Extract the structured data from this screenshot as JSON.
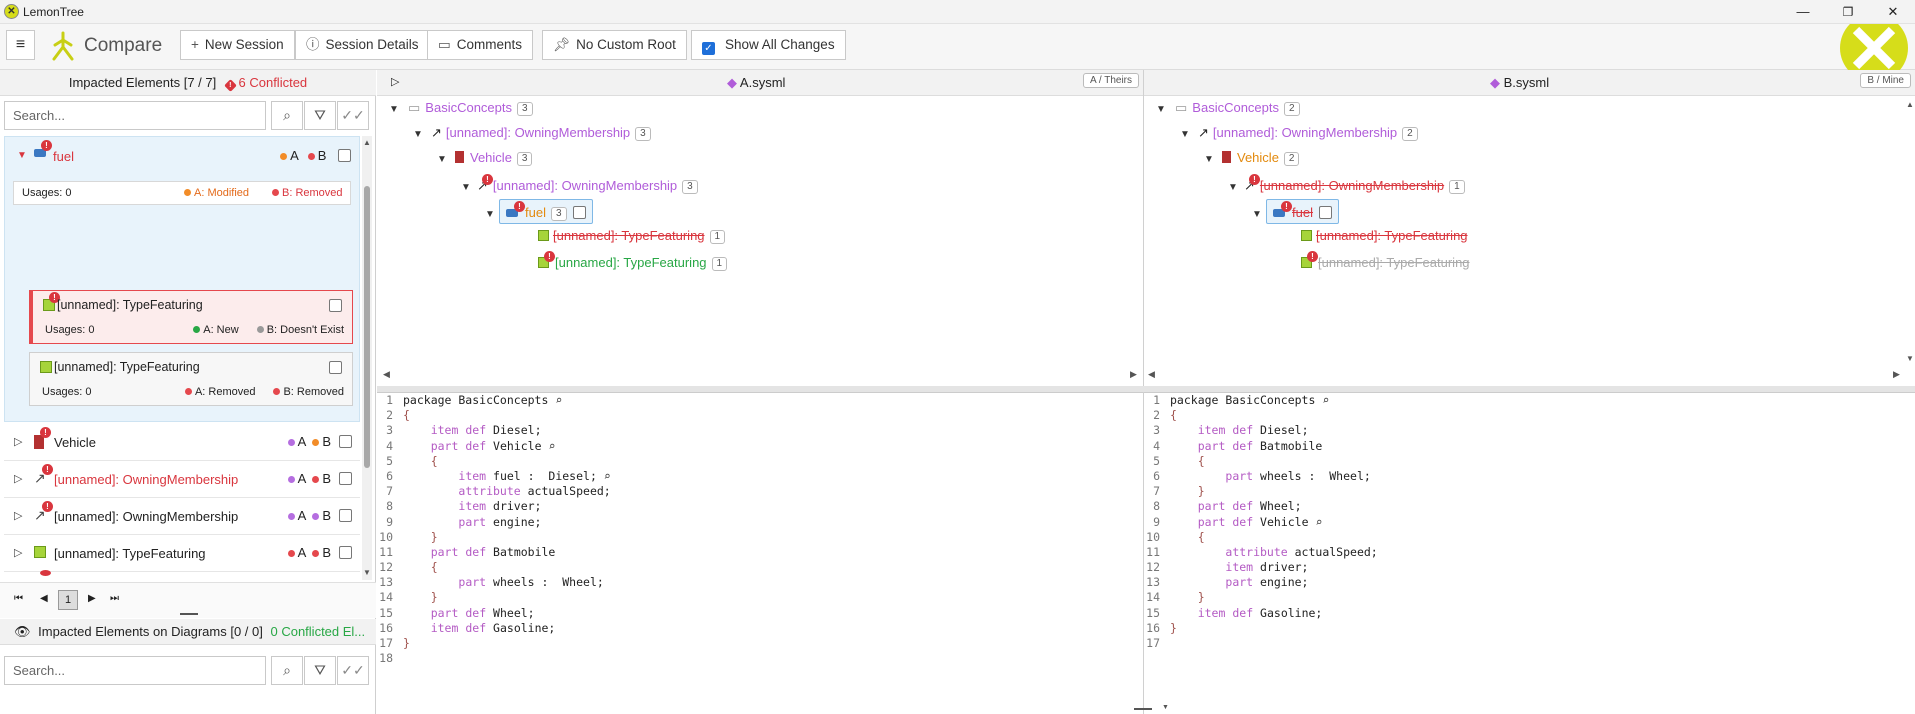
{
  "window": {
    "title": "LemonTree",
    "minimize": "—",
    "maximize": "❐",
    "close": "✕"
  },
  "toolbar": {
    "menu_icon": "≡",
    "app_name": "Compare",
    "new_session": "New Session",
    "session_details": "Session Details",
    "comments": "Comments",
    "no_custom_root": "No Custom Root",
    "show_all_changes": "Show All Changes"
  },
  "impacted": {
    "header": "Impacted Elements [7 / 7]",
    "conflicted": "6 Conflicted",
    "search_placeholder": "Search...",
    "rows": [
      {
        "name": "fuel",
        "a": "A",
        "b": "B"
      },
      {
        "name": "Vehicle",
        "a": "A",
        "b": "B"
      },
      {
        "name": "[unnamed]: OwningMembership",
        "a": "A",
        "b": "B"
      },
      {
        "name": "[unnamed]: OwningMembership",
        "a": "A",
        "b": "B"
      },
      {
        "name": "[unnamed]: TypeFeaturing",
        "a": "A",
        "b": "B"
      }
    ],
    "fuel_detail": {
      "usages": "Usages: 0",
      "a_status": "A: Modified",
      "b_status": "B: Removed"
    },
    "cards": [
      {
        "title": "[unnamed]: TypeFeaturing",
        "usages": "Usages: 0",
        "a_status": "A: New",
        "b_status": "B: Doesn't Exist"
      },
      {
        "title": "[unnamed]: TypeFeaturing",
        "usages": "Usages: 0",
        "a_status": "A: Removed",
        "b_status": "B: Removed"
      }
    ],
    "page": "1"
  },
  "diagrams": {
    "header": "Impacted Elements on Diagrams [0 / 0]",
    "conflicted": "0 Conflicted El...",
    "search_placeholder": "Search..."
  },
  "panes": {
    "a": {
      "file": "A.sysml",
      "tag": "A / Theirs"
    },
    "b": {
      "file": "B.sysml",
      "tag": "B / Mine"
    }
  },
  "tree_a": [
    {
      "label": "BasicConcepts",
      "count": "3"
    },
    {
      "label": "[unnamed]: OwningMembership",
      "count": "3"
    },
    {
      "label": "Vehicle",
      "count": "3"
    },
    {
      "label": "[unnamed]: OwningMembership",
      "count": "3"
    },
    {
      "label": "fuel",
      "count": "3"
    },
    {
      "label": "[unnamed]: TypeFeaturing",
      "count": "1"
    },
    {
      "label": "[unnamed]: TypeFeaturing",
      "count": "1"
    }
  ],
  "tree_b": [
    {
      "label": "BasicConcepts",
      "count": "2"
    },
    {
      "label": "[unnamed]: OwningMembership",
      "count": "2"
    },
    {
      "label": "Vehicle",
      "count": "2"
    },
    {
      "label": "[unnamed]: OwningMembership",
      "count": "1"
    },
    {
      "label": "fuel"
    },
    {
      "label": "[unnamed]: TypeFeaturing"
    },
    {
      "label": "[unnamed]: TypeFeaturing"
    }
  ],
  "code_a": [
    "package BasicConcepts",
    "{",
    "    item def Diesel;",
    "    part def Vehicle",
    "    {",
    "        item fuel :  Diesel;",
    "        attribute actualSpeed;",
    "        item driver;",
    "        part engine;",
    "    }",
    "    part def Batmobile",
    "    {",
    "        part wheels :  Wheel;",
    "    }",
    "    part def Wheel;",
    "    item def Gasoline;",
    "}",
    ""
  ],
  "code_b": [
    "package BasicConcepts",
    "{",
    "    item def Diesel;",
    "    part def Batmobile",
    "    {",
    "        part wheels :  Wheel;",
    "    }",
    "    part def Wheel;",
    "    part def Vehicle",
    "    {",
    "        attribute actualSpeed;",
    "        item driver;",
    "        part engine;",
    "    }",
    "    item def Gasoline;",
    "}",
    ""
  ]
}
